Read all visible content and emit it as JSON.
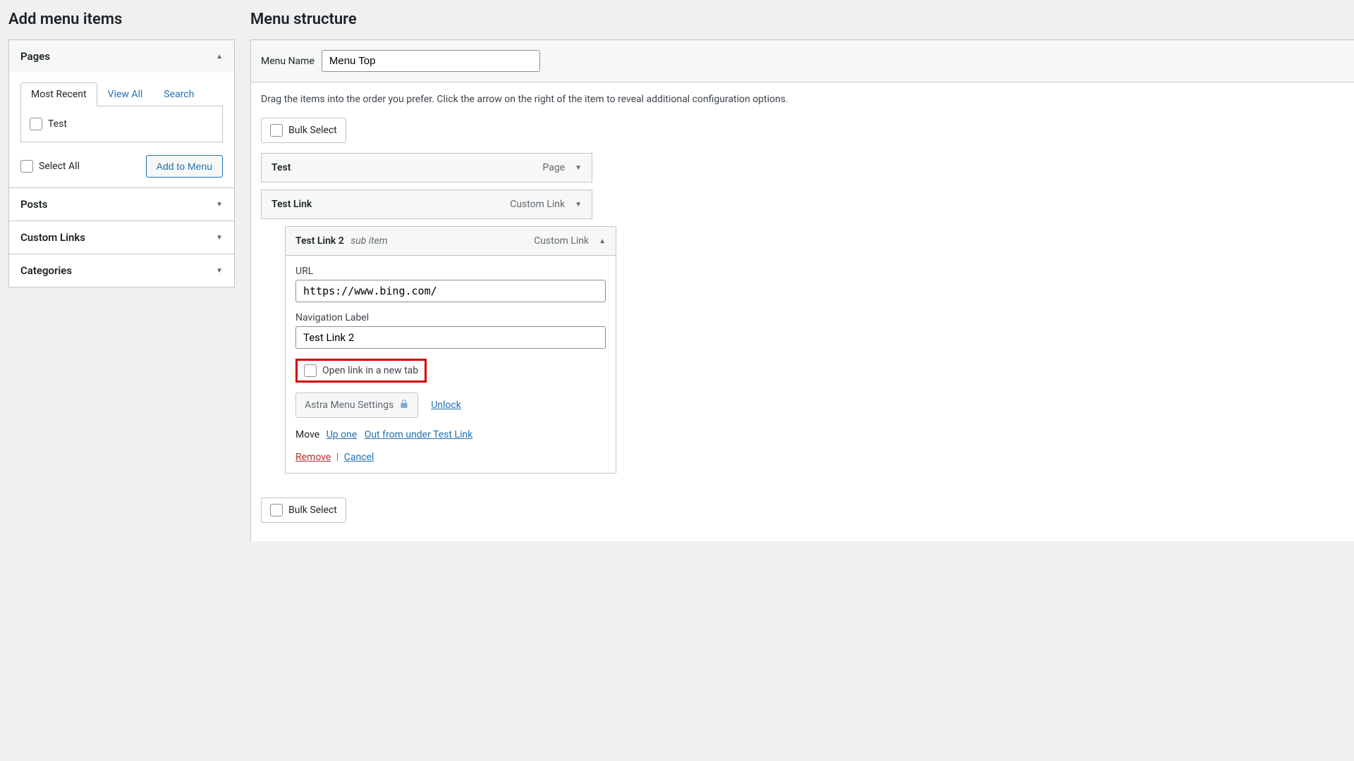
{
  "left": {
    "title": "Add menu items",
    "pages": {
      "label": "Pages",
      "tabs": {
        "recent": "Most Recent",
        "viewall": "View All",
        "search": "Search"
      },
      "items": [
        {
          "label": "Test"
        }
      ],
      "select_all": "Select All",
      "add_btn": "Add to Menu"
    },
    "posts": "Posts",
    "custom_links": "Custom Links",
    "categories": "Categories"
  },
  "right": {
    "title": "Menu structure",
    "menu_name_label": "Menu Name",
    "menu_name_value": "Menu Top",
    "instructions": "Drag the items into the order you prefer. Click the arrow on the right of the item to reveal additional configuration options.",
    "bulk_select": "Bulk Select",
    "items": {
      "item1": {
        "title": "Test",
        "type": "Page"
      },
      "item2": {
        "title": "Test Link",
        "type": "Custom Link"
      },
      "item3": {
        "title": "Test Link 2",
        "sublabel": "sub item",
        "type": "Custom Link",
        "url_label": "URL",
        "url_value": "https://www.bing.com/",
        "nav_label": "Navigation Label",
        "nav_value": "Test Link 2",
        "newtab_label": "Open link in a new tab",
        "astra_label": "Astra Menu Settings",
        "unlock": "Unlock",
        "move_label": "Move",
        "move_up": "Up one",
        "move_out": "Out from under Test Link",
        "remove": "Remove",
        "cancel": "Cancel"
      }
    }
  }
}
